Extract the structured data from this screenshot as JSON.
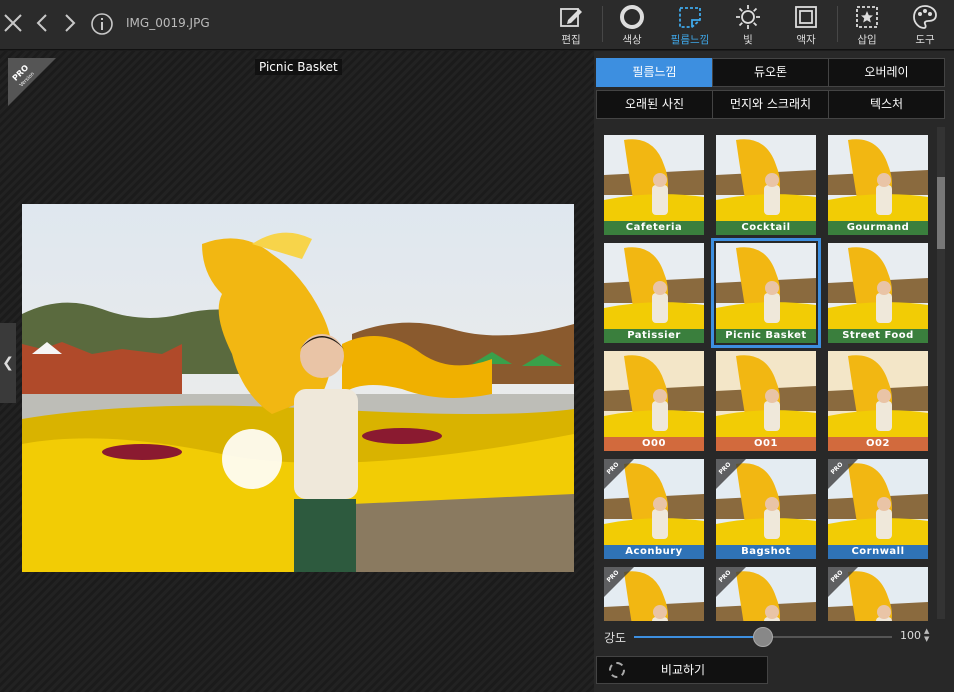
{
  "topbar": {
    "filename": "IMG_0019.JPG",
    "tools": [
      {
        "label": "편집",
        "icon": "edit-icon"
      },
      {
        "label": "색상",
        "icon": "color-icon"
      },
      {
        "label": "필름느낌",
        "icon": "film-icon",
        "active": true
      },
      {
        "label": "빛",
        "icon": "light-icon"
      },
      {
        "label": "액자",
        "icon": "frame-icon"
      },
      {
        "label": "삽입",
        "icon": "insert-icon"
      },
      {
        "label": "도구",
        "icon": "palette-icon"
      }
    ]
  },
  "canvas": {
    "filter_title": "Picnic Basket",
    "pro_badge": "PRO",
    "pro_badge_sub": "Version"
  },
  "panel": {
    "tabs_row1": [
      "필름느낌",
      "듀오톤",
      "오버레이"
    ],
    "tabs_row2": [
      "오래된 사진",
      "먼지와 스크래치",
      "텍스처"
    ],
    "filters": [
      {
        "name": "Cafeteria",
        "color": "green"
      },
      {
        "name": "Cocktail",
        "color": "green"
      },
      {
        "name": "Gourmand",
        "color": "green"
      },
      {
        "name": "Patissier",
        "color": "green"
      },
      {
        "name": "Picnic Basket",
        "color": "green",
        "selected": true
      },
      {
        "name": "Street Food",
        "color": "green"
      },
      {
        "name": "O00",
        "color": "orange"
      },
      {
        "name": "O01",
        "color": "orange"
      },
      {
        "name": "O02",
        "color": "orange"
      },
      {
        "name": "Aconbury",
        "color": "blue",
        "pro": true
      },
      {
        "name": "Bagshot",
        "color": "blue",
        "pro": true
      },
      {
        "name": "Cornwall",
        "color": "blue",
        "pro": true
      },
      {
        "name": "",
        "color": "blue",
        "pro": true
      },
      {
        "name": "",
        "color": "blue",
        "pro": true
      },
      {
        "name": "",
        "color": "blue",
        "pro": true
      }
    ],
    "strength_label": "강도",
    "strength_value": "100",
    "strength_fraction": 0.5,
    "compare_label": "비교하기"
  },
  "colors": {
    "accent": "#3d8fe0",
    "green_label": "#3a7f3d",
    "orange_label": "#d26a3d",
    "blue_label": "#2f73b7"
  }
}
